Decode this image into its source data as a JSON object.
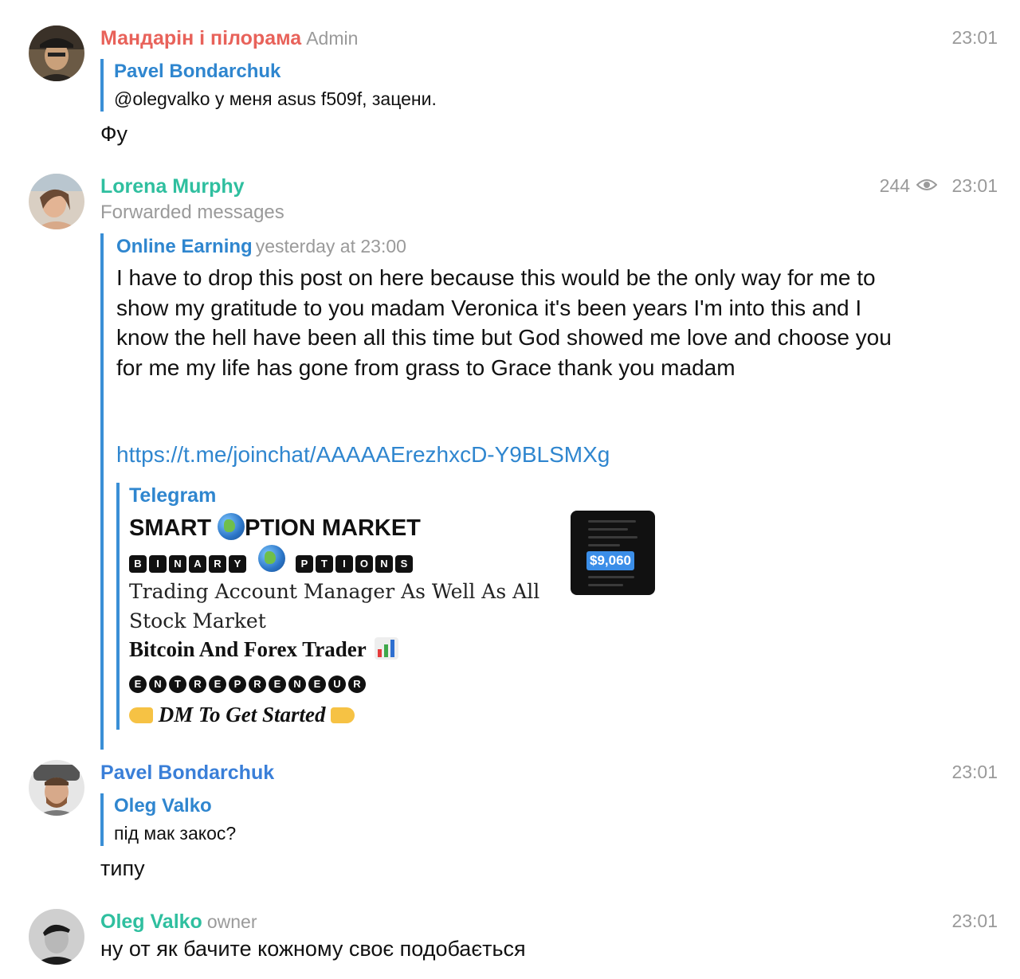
{
  "messages": {
    "m1": {
      "author": "Мандарін і пілорама",
      "author_color": "#e8625a",
      "role": "Admin",
      "time": "23:01",
      "reply_name": "Pavel Bondarchuk",
      "reply_text": "@olegvalko у меня asus f509f, зацени.",
      "text": "Фу"
    },
    "m2": {
      "author": "Lorena Murphy",
      "author_color": "#2fbf9f",
      "forwarded_label": "Forwarded messages",
      "views": "244",
      "time": "23:01",
      "fwd_channel": "Online Earning",
      "fwd_date": "yesterday at 23:00",
      "fwd_text": "I have to drop this post on here because this would be the only way for me to show my gratitude to you madam Veronica it's been years I'm into this and I know the hell have been all this time but God showed me love and choose you for me my life has gone from grass to Grace thank you madam",
      "link": "https://t.me/joinchat/AAAAAErezhxcD-Y9BLSMXg",
      "preview": {
        "site": "Telegram",
        "title_a": "SMART",
        "title_b": "PTION MARKET",
        "line2_a": [
          "B",
          "I",
          "N",
          "A",
          "R",
          "Y"
        ],
        "line2_b": [
          "P",
          "T",
          "I",
          "O",
          "N",
          "S"
        ],
        "line3": "Trading Account Manager As Well As All",
        "line4": "Stock Market",
        "line5": "Bitcoin And Forex Trader",
        "line6": [
          "E",
          "N",
          "T",
          "R",
          "E",
          "P",
          "R",
          "E",
          "N",
          "E",
          "U",
          "R"
        ],
        "line7": "DM To Get Started",
        "thumb_badge": "$9,060"
      }
    },
    "m3": {
      "author": "Pavel Bondarchuk",
      "author_color": "#3a7fd8",
      "time": "23:01",
      "reply_name": "Oleg Valko",
      "reply_text": "під мак закос?",
      "text": "типу"
    },
    "m4": {
      "author": "Oleg Valko",
      "author_color": "#2fbf9f",
      "role": "owner",
      "time": "23:01",
      "text": "ну от як бачите кожному своє подобається"
    }
  }
}
